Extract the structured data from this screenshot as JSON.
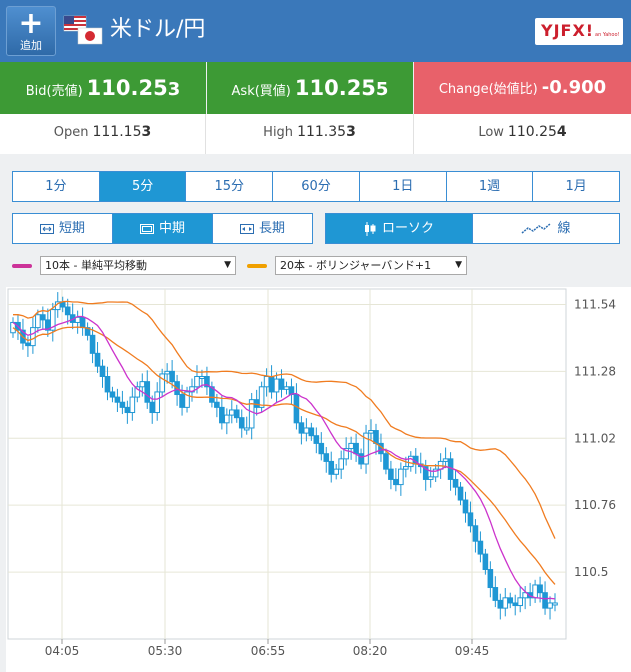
{
  "header": {
    "add_label": "追加",
    "pair": "米ドル/円",
    "logo_text": "YJFX!",
    "logo_sub": "an Yahoo!"
  },
  "quote": {
    "bid_label": "Bid(売値)",
    "bid_main": "110.25",
    "bid_pip": "3",
    "ask_label": "Ask(買値)",
    "ask_main": "110.25",
    "ask_pip": "5",
    "change_label": "Change(始値比)",
    "change_value": "-0.900"
  },
  "ohl": {
    "open_label": "Open",
    "open_main": "111.15",
    "open_pip": "3",
    "high_label": "High",
    "high_main": "111.35",
    "high_pip": "3",
    "low_label": "Low",
    "low_main": "110.25",
    "low_pip": "4"
  },
  "intervals": [
    "1分",
    "5分",
    "15分",
    "60分",
    "1日",
    "1週",
    "1月"
  ],
  "interval_active": 1,
  "range": [
    "短期",
    "中期",
    "長期"
  ],
  "range_active": 1,
  "chart_types": [
    "ローソク",
    "線"
  ],
  "chart_type_active": 0,
  "indicators": {
    "ind1": {
      "value": "10本 - 単純平均移動",
      "color": "#cc3399"
    },
    "ind2": {
      "value": "20本 - ボリンジャーバンド+1",
      "color": "#f0a000"
    }
  },
  "colors": {
    "candle": "#1f97d4",
    "ma": "#cc33cc",
    "band": "#f07c20"
  },
  "chart_data": {
    "type": "candlestick",
    "interval": "5分",
    "y_ticks": [
      111.54,
      111.28,
      111.02,
      110.76,
      110.5
    ],
    "y_tick_labels": [
      "111.54",
      "111.28",
      "111.02",
      "110.76",
      "110.5"
    ],
    "x_tick_labels": [
      "04:05",
      "05:30",
      "06:55",
      "08:20",
      "09:45"
    ],
    "ylim": [
      110.24,
      111.6
    ],
    "candle_count": 110,
    "candle_close": [
      111.47,
      111.44,
      111.39,
      111.38,
      111.45,
      111.5,
      111.48,
      111.44,
      111.52,
      111.55,
      111.53,
      111.5,
      111.47,
      111.49,
      111.45,
      111.42,
      111.35,
      111.3,
      111.26,
      111.2,
      111.18,
      111.16,
      111.14,
      111.12,
      111.18,
      111.22,
      111.24,
      111.16,
      111.12,
      111.2,
      111.27,
      111.28,
      111.24,
      111.19,
      111.14,
      111.2,
      111.22,
      111.26,
      111.26,
      111.22,
      111.16,
      111.14,
      111.08,
      111.11,
      111.13,
      111.1,
      111.06,
      111.06,
      111.17,
      111.14,
      111.22,
      111.26,
      111.2,
      111.25,
      111.21,
      111.22,
      111.19,
      111.08,
      111.04,
      111.06,
      111.03,
      111.0,
      110.96,
      110.93,
      110.88,
      110.9,
      110.94,
      110.98,
      111.0,
      110.96,
      110.92,
      111.04,
      111.05,
      111.0,
      110.96,
      110.9,
      110.86,
      110.84,
      110.9,
      110.91,
      110.95,
      110.92,
      110.91,
      110.86,
      110.87,
      110.9,
      110.93,
      110.94,
      110.86,
      110.83,
      110.78,
      110.73,
      110.68,
      110.62,
      110.57,
      110.51,
      110.44,
      110.39,
      110.36,
      110.4,
      110.38,
      110.37,
      110.4,
      110.42,
      110.4,
      110.45,
      110.42,
      110.36,
      110.38,
      110.38
    ]
  }
}
